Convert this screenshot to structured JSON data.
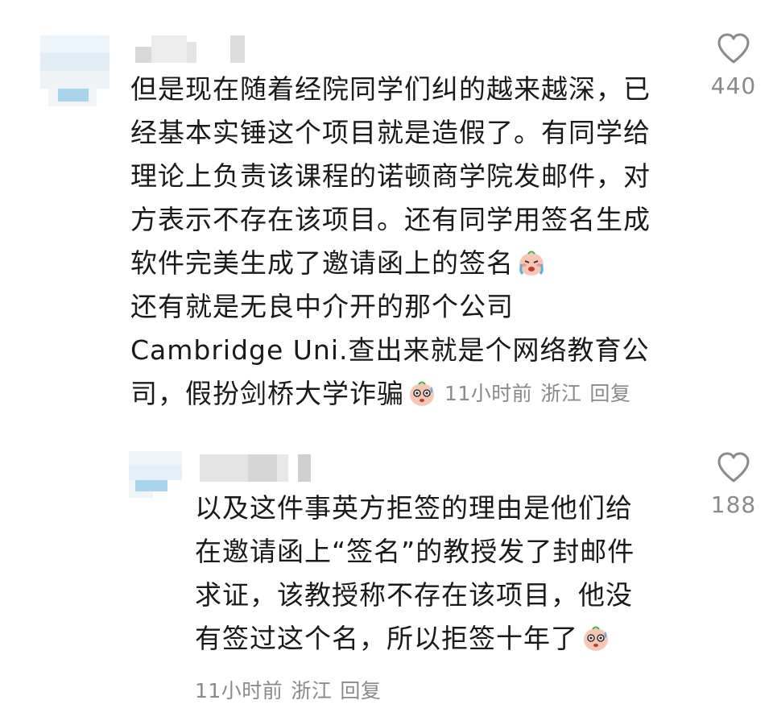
{
  "comments": [
    {
      "username": "",
      "lines": [
        "但是现在随着经院同学们纠的越来越深，已",
        "经基本实锤这个项目就是造假了。有同学给",
        "理论上负责该课程的诺顿商学院发邮件，对",
        "方表示不存在该项目。还有同学用签名生成",
        "软件完美生成了邀请函上的签名",
        "还有就是无良中介开的那个公司",
        "Cambridge Uni.查出来就是个网络教育公",
        "司，假扮剑桥大学诈骗"
      ],
      "emoji_1": "crying-face-emoji",
      "emoji_2": "sweating-face-emoji",
      "time": "11小时前",
      "location": "浙江",
      "reply_label": "回复",
      "like_icon": "heart-outline-icon",
      "likes": "440"
    },
    {
      "username": "",
      "lines": [
        "以及这件事英方拒签的理由是他们给",
        "在邀请函上“签名”的教授发了封邮件",
        "求证，该教授称不存在该项目，他没",
        "有签过这个名，所以拒签十年了"
      ],
      "emoji_1": "sweating-face-emoji",
      "time": "11小时前",
      "location": "浙江",
      "reply_label": "回复",
      "like_icon": "heart-outline-icon",
      "likes": "188"
    }
  ],
  "colors": {
    "text": "#1a1a1a",
    "meta": "#8a8a8a",
    "avatar_blue": "#a9d4ee"
  }
}
